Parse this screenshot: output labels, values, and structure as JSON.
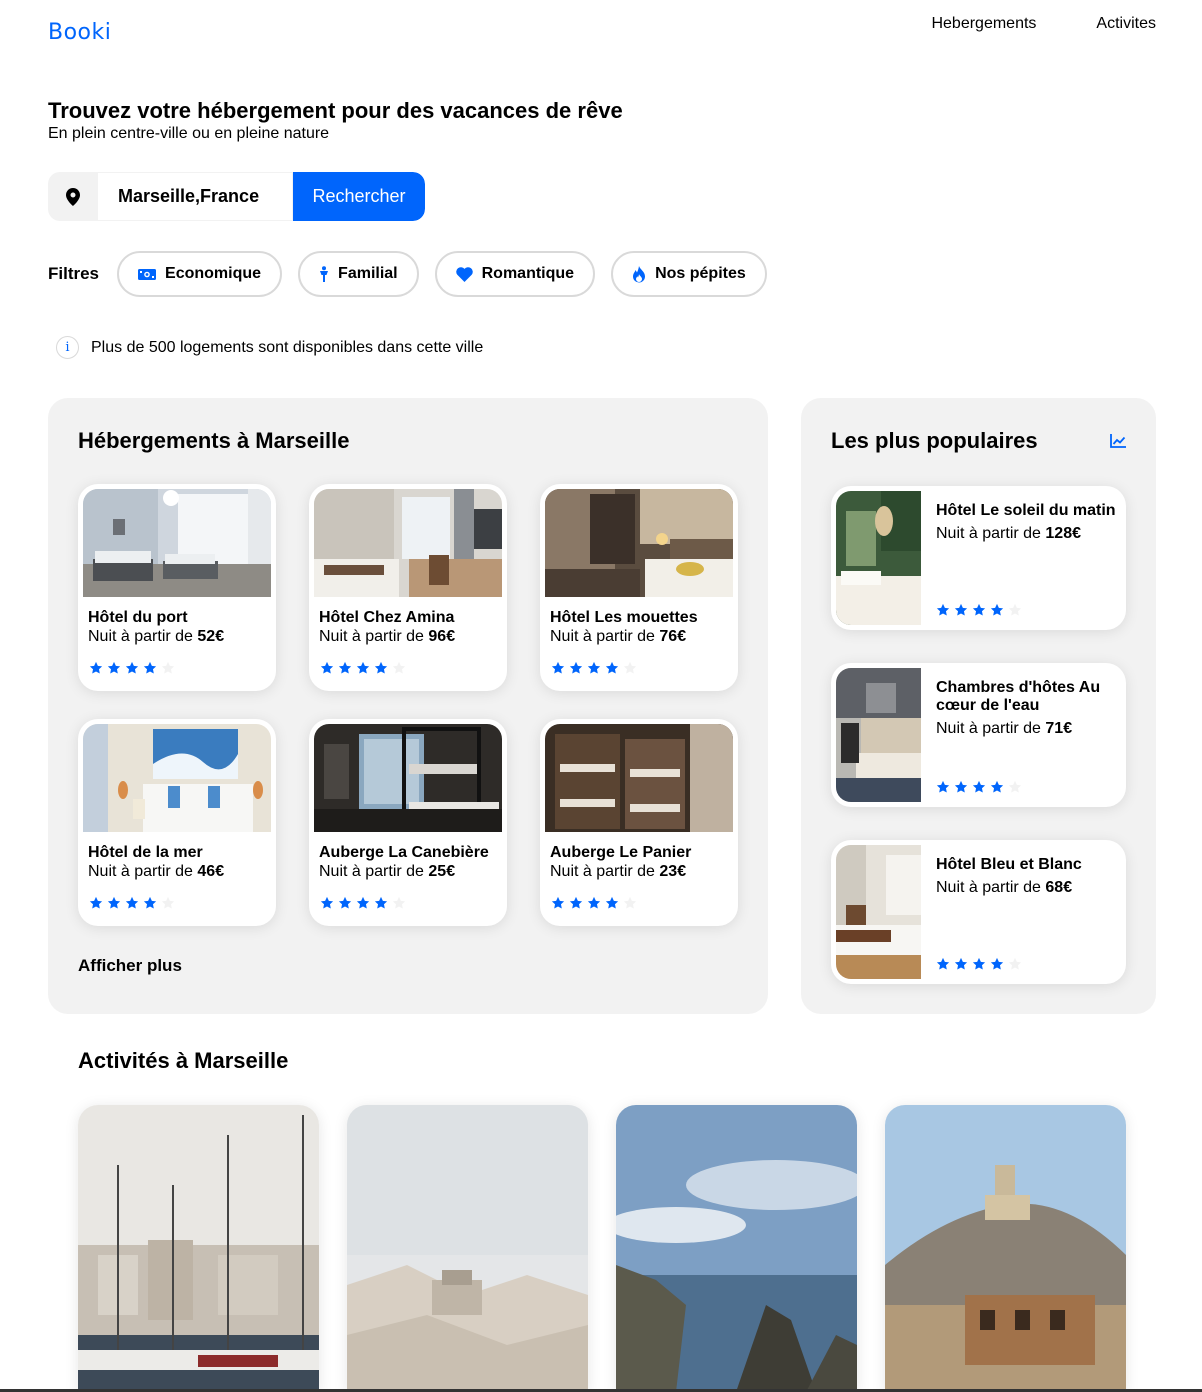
{
  "brand": {
    "logo": "Booki",
    "accent": "#0065FC"
  },
  "nav": {
    "items": [
      "Hebergements",
      "Activites"
    ]
  },
  "hero": {
    "title": "Trouvez votre hébergement pour des vacances de rêve",
    "subtitle": "En plein centre-ville ou en pleine nature"
  },
  "search": {
    "icon": "location-pin-icon",
    "value": "Marseille,France",
    "button": "Rechercher"
  },
  "filters": {
    "label": "Filtres",
    "items": [
      {
        "label": "Economique",
        "icon": "money-icon"
      },
      {
        "label": "Familial",
        "icon": "child-icon"
      },
      {
        "label": "Romantique",
        "icon": "heart-icon"
      },
      {
        "label": "Nos pépites",
        "icon": "fire-icon"
      }
    ]
  },
  "info": {
    "icon": "info-icon",
    "text": "Plus de 500 logements sont disponibles dans cette ville"
  },
  "hebergements": {
    "title": "Hébergements à Marseille",
    "price_prefix": "Nuit à partir de",
    "items": [
      {
        "name": "Hôtel du port",
        "price_prefix": "Nuit à partir de",
        "price": "52€",
        "rating": 4
      },
      {
        "name": "Hôtel Chez Amina",
        "price_prefix": "Nuit à partir de",
        "price": "96€",
        "rating": 4
      },
      {
        "name": "Hôtel Les mouettes",
        "price_prefix": "Nuit à partir de",
        "price": "76€",
        "rating": 4
      },
      {
        "name": "Hôtel de la mer",
        "price_prefix": "Nuit à partir de",
        "price": "46€",
        "rating": 4
      },
      {
        "name": "Auberge La Canebière",
        "price_prefix": "Nuit à partir de",
        "price": "25€",
        "rating": 4
      },
      {
        "name": "Auberge Le Panier",
        "price_prefix": "Nuit à partir de",
        "price": "23€",
        "rating": 4
      }
    ],
    "more": "Afficher plus"
  },
  "populaires": {
    "title": "Les plus populaires",
    "icon": "trend-chart-icon",
    "items": [
      {
        "name": "Hôtel Le soleil du matin",
        "price_prefix": "Nuit à partir de",
        "price": "128€",
        "rating": 4
      },
      {
        "name": "Chambres d'hôtes Au cœur de l'eau",
        "price_prefix": "Nuit à partir de",
        "price": "71€",
        "rating": 4
      },
      {
        "name": "Hôtel Bleu et Blanc",
        "price_prefix": "Nuit à partir de",
        "price": "68€",
        "rating": 4
      }
    ]
  },
  "activites": {
    "title": "Activités à Marseille"
  }
}
